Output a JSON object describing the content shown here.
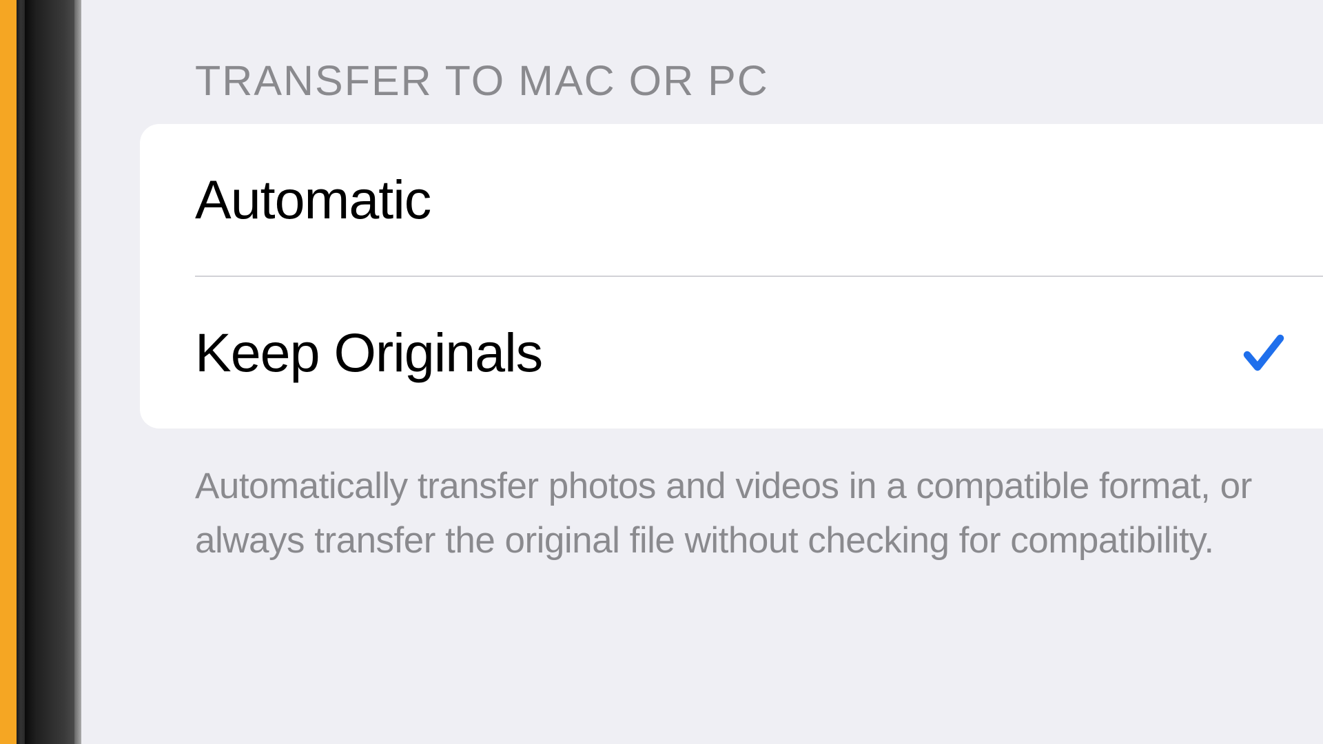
{
  "section": {
    "header": "TRANSFER TO MAC OR PC",
    "options": [
      {
        "label": "Automatic",
        "selected": false
      },
      {
        "label": "Keep Originals",
        "selected": true
      }
    ],
    "footer": "Automatically transfer photos and videos in a compatible format, or always transfer the original file without checking for compatibility."
  },
  "colors": {
    "checkmark": "#1f6fec"
  }
}
